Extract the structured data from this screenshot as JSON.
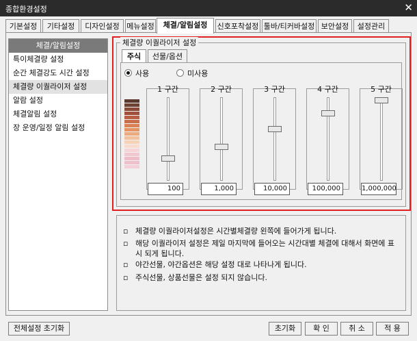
{
  "window": {
    "title": "종합환경설정",
    "close_glyph": "✕"
  },
  "tabs": [
    {
      "label": "기본설정"
    },
    {
      "label": "기타설정"
    },
    {
      "label": "디자인설정"
    },
    {
      "label": "메뉴설정"
    },
    {
      "label": "체결/알림설정",
      "active": true
    },
    {
      "label": "신호포착설정"
    },
    {
      "label": "툴바/티커바설정"
    },
    {
      "label": "보안설정"
    },
    {
      "label": "설정관리"
    }
  ],
  "sidebar": {
    "header": "체결/알림설정",
    "items": [
      {
        "label": "특이체결량 설정"
      },
      {
        "label": "순간 체결강도 시간 설정"
      },
      {
        "label": "체결량 이퀄라이저 설정",
        "selected": true
      },
      {
        "label": "알람 설정"
      },
      {
        "label": "체결알림 설정"
      },
      {
        "label": "장 운영/일정 알림 설정"
      }
    ]
  },
  "equalizer": {
    "group_title": "체결량 이퀄라이저 설정",
    "subtabs": [
      {
        "label": "주식",
        "active": true
      },
      {
        "label": "선물/옵션"
      }
    ],
    "radio_on": "사용",
    "radio_off": "미사용",
    "gradient_colors": [
      "#5a3a2e",
      "#6e4232",
      "#8a4a36",
      "#a0503c",
      "#b85e42",
      "#c86e4a",
      "#d88256",
      "#e49464",
      "#ecaa80",
      "#f2c09c",
      "#f6d2b6",
      "#f8dcd0",
      "#f6d4d8",
      "#f2c8d0",
      "#f0bcc8",
      "#eec0cc",
      "#f2d0d8"
    ],
    "sections": [
      {
        "label": "1 구간",
        "value": "100",
        "level": 0.25
      },
      {
        "label": "2 구간",
        "value": "1,000",
        "level": 0.4
      },
      {
        "label": "3 구간",
        "value": "10,000",
        "level": 0.63
      },
      {
        "label": "4 구간",
        "value": "100,000",
        "level": 0.83
      },
      {
        "label": "5 구간",
        "value": "1,000,000",
        "level": 1.0
      }
    ]
  },
  "notes": {
    "bullet": "▫",
    "lines": [
      "체결량 이퀄라이저설정은 시간별체결량 왼쪽에 들어가게 됩니다.",
      "해당 이퀄라이저 설정은 제일 마지막에 들어오는 시간대별 체결에 대해서 화면에 표시 되게 됩니다.",
      "야간선물, 야간옵션은 해당 설정 대로 나타나게 됩니다.",
      "주식선물, 상품선물은 설정 되지 않습니다."
    ]
  },
  "buttons": {
    "reset_all": "전체설정 초기화",
    "reset": "초기화",
    "ok": "확 인",
    "cancel": "취 소",
    "apply": "적 용"
  }
}
